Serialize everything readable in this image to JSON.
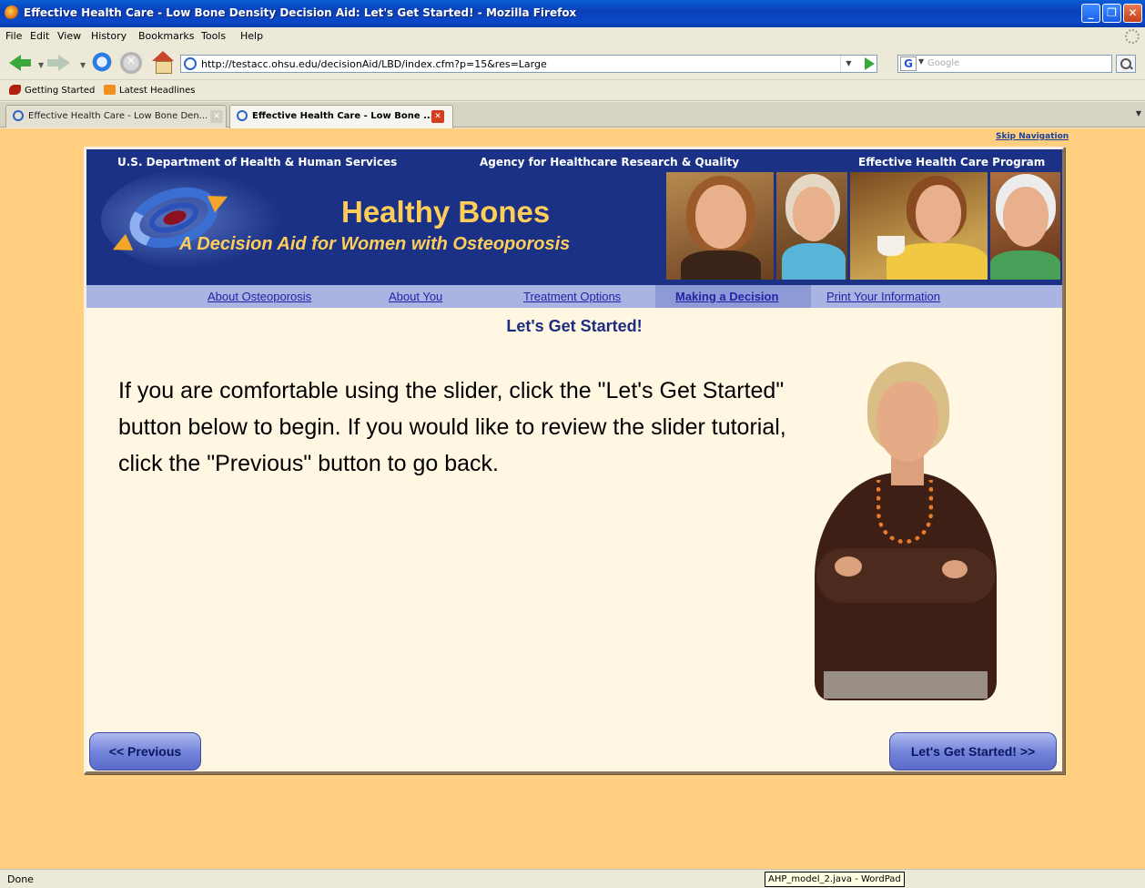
{
  "window": {
    "title": "Effective Health Care - Low Bone Density Decision Aid: Let's Get Started! - Mozilla Firefox",
    "controls": [
      "minimize-icon",
      "restore-icon",
      "close-icon"
    ]
  },
  "menu": [
    "File",
    "Edit",
    "View",
    "History",
    "Bookmarks",
    "Tools",
    "Help"
  ],
  "navigation": {
    "url": "http://testacc.ohsu.edu/decisionAid/LBD/index.cfm?p=15&res=Large",
    "search_placeholder": "Google",
    "search_engine_icon": "G"
  },
  "bookmarks": [
    "Getting Started",
    "Latest Headlines"
  ],
  "tabs": [
    {
      "label": "Effective Health Care - Low Bone Den...",
      "active": false
    },
    {
      "label": "Effective Health Care - Low Bone ...",
      "active": true
    }
  ],
  "page": {
    "skip_navigation": "Skip Navigation",
    "banner": {
      "left_header": "U.S. Department of Health & Human Services",
      "center_header": "Agency for Healthcare Research & Quality",
      "right_header": "Effective Health Care Program",
      "title": "Healthy Bones",
      "subtitle": "A Decision Aid for Women with Osteoporosis"
    },
    "nav_links": [
      {
        "label": "About Osteoporosis",
        "active": false
      },
      {
        "label": "About You",
        "active": false
      },
      {
        "label": "Treatment Options",
        "active": false
      },
      {
        "label": "Making a Decision",
        "active": true
      },
      {
        "label": "Print Your Information",
        "active": false
      }
    ],
    "heading": "Let's Get Started!",
    "body": "If you are comfortable using the slider, click the \"Let's Get Started\" button below to begin. If you would like to review the slider tutorial, click the \"Previous\" button to go back.",
    "prev_button": "<< Previous",
    "next_button": "Let's Get Started! >>"
  },
  "status": {
    "text": "Done",
    "tooltip": "AHP_model_2.java - WordPad"
  },
  "colors": {
    "page_background": "#ffcf7f",
    "banner_background": "#1a3185",
    "banner_title": "#ffce5a",
    "nav_strip": "#aab4e2",
    "heading_text": "#1d2c82"
  }
}
